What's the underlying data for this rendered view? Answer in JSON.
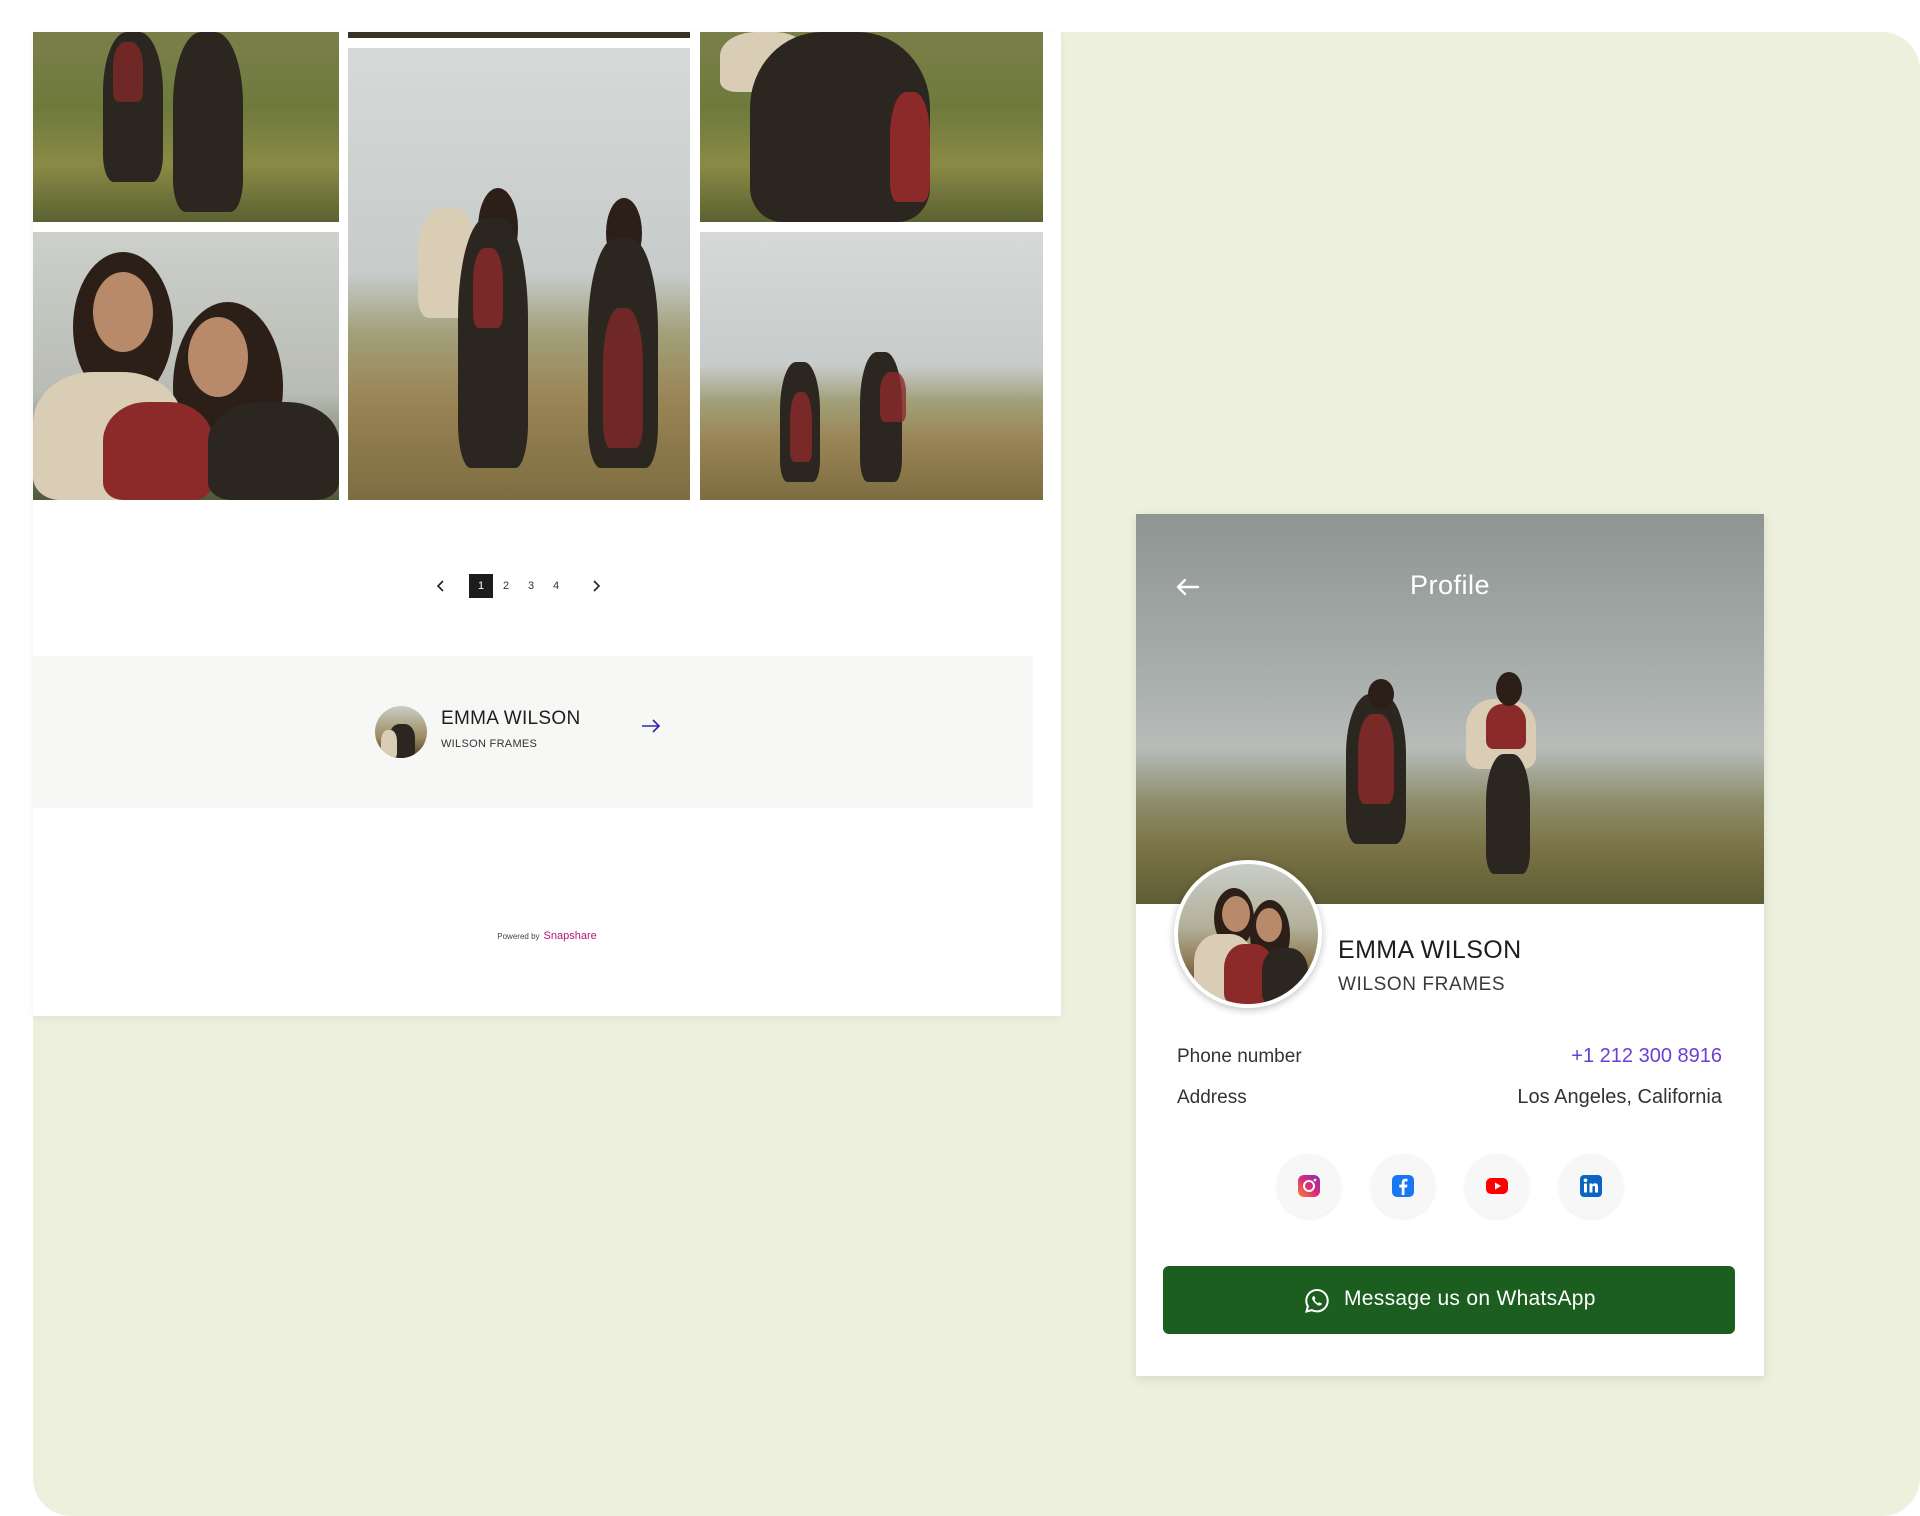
{
  "gallery": {
    "pagination": {
      "prev_icon": "chevron-left-icon",
      "pages": [
        "1",
        "2",
        "3",
        "4"
      ],
      "active_page": "1",
      "next_icon": "chevron-right-icon"
    },
    "author": {
      "name": "EMMA WILSON",
      "company": "WILSON FRAMES",
      "arrow_icon": "arrow-right-icon"
    },
    "footer": {
      "powered_label": "Powered by",
      "brand": "Snapshare"
    }
  },
  "profile": {
    "title": "Profile",
    "back_icon": "arrow-left-icon",
    "name": "EMMA WILSON",
    "company": "WILSON FRAMES",
    "details": [
      {
        "label": "Phone number",
        "value": "+1 212 300 8916"
      },
      {
        "label": "Address",
        "value": "Los Angeles, California"
      }
    ],
    "socials": [
      "instagram-icon",
      "facebook-icon",
      "youtube-icon",
      "linkedin-icon"
    ],
    "whatsapp_label": "Message us on WhatsApp"
  },
  "colors": {
    "background": "#eef0de",
    "whatsapp_button": "#1b5e20",
    "phone_link": "#6a3fd6",
    "brand": "#b3157a",
    "active_page": "#1c1c1c"
  }
}
